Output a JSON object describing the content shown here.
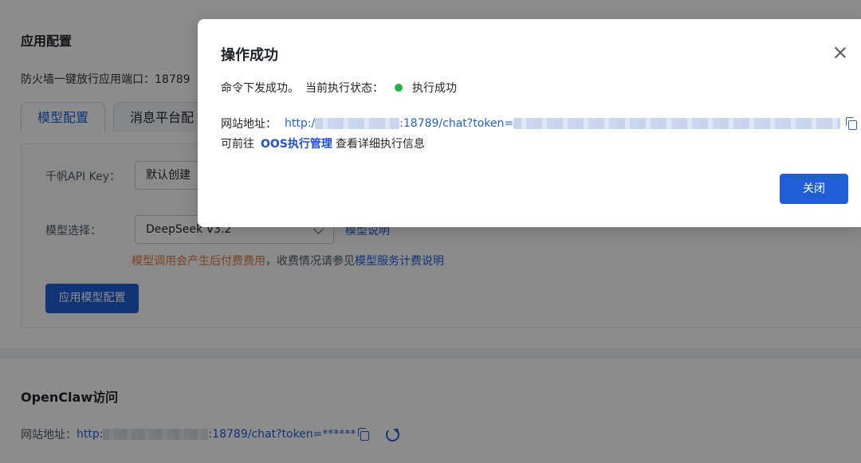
{
  "page": {
    "section_title": "应用配置",
    "firewall_label": "防火墙一键放行应用端口：",
    "firewall_port": "18789",
    "tabs": [
      {
        "label": "模型配置",
        "active": true
      },
      {
        "label": "消息平台配",
        "active": false
      }
    ],
    "api_key_label": "千帆API Key：",
    "api_key_value": "默认创建",
    "model_label": "模型选择：",
    "model_value": "DeepSeek V3.2",
    "model_doc_link": "模型说明",
    "billing_warning": "模型调用会产生后付费费用",
    "billing_mid": "，收费情况请参见",
    "billing_link": "模型服务计费说明",
    "apply_button": "应用模型配置",
    "openclaw_title": "OpenClaw访问",
    "site_label": "网站地址：",
    "site_url_prefix": "http:",
    "site_url_suffix": ":18789/chat?token=******"
  },
  "modal": {
    "title": "操作成功",
    "command_text": "命令下发成功。",
    "status_label": "当前执行状态：",
    "status_value": "执行成功",
    "status_color": "#22b14c",
    "url_label": "网站地址：",
    "url_prefix": "http:/",
    "url_middle": ":18789/chat?token=",
    "goto_prefix": "可前往",
    "oos_link": "OOS执行管理",
    "goto_suffix": "查看详细执行信息",
    "close_button": "关闭"
  },
  "colors": {
    "primary": "#1e5fd8",
    "warning": "#e07b39",
    "success": "#22b14c"
  }
}
